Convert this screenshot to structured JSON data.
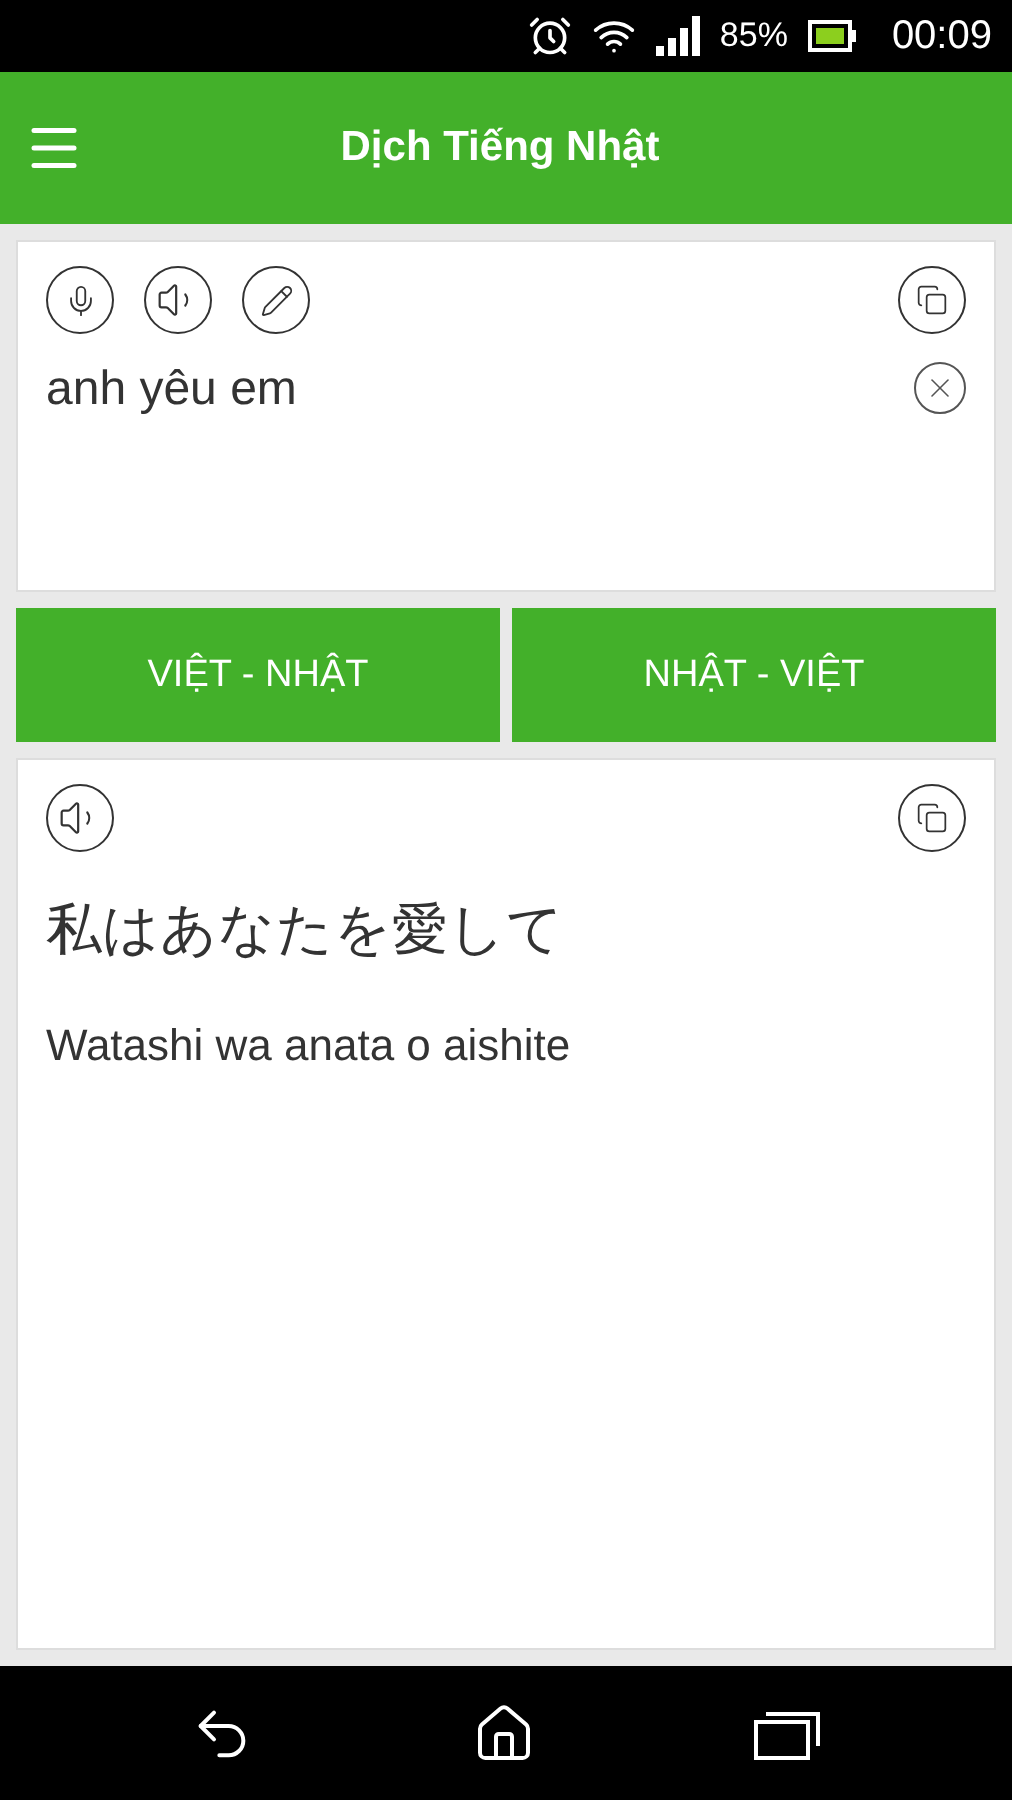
{
  "status_bar": {
    "battery": "85%",
    "time": "00:09"
  },
  "app_bar": {
    "title": "Dịch Tiếng Nhật"
  },
  "input_card": {
    "value": "anh yêu em"
  },
  "direction_buttons": [
    {
      "label": "VIỆT - NHẬT"
    },
    {
      "label": "NHẬT - VIỆT"
    }
  ],
  "output_card": {
    "translation": "私はあなたを愛して",
    "romaji": "Watashi wa anata o aishite"
  }
}
